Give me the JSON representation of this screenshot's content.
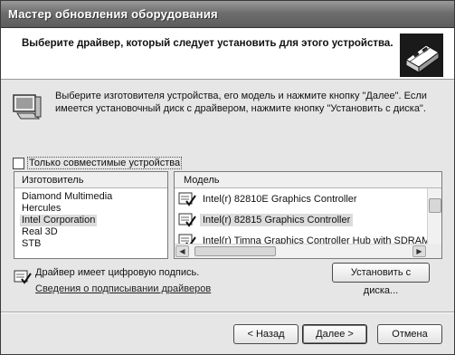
{
  "window": {
    "title": "Мастер обновления оборудования"
  },
  "header": {
    "heading": "Выберите драйвер, который следует установить для этого устройства."
  },
  "info": {
    "line1": "Выберите изготовителя устройства, его модель и нажмите кнопку \"Далее\". Если",
    "line2": "имеется установочный диск с  драйвером, нажмите кнопку \"Установить с диска\"."
  },
  "compatible": {
    "label": "Только совместимые устройства",
    "checked": false
  },
  "manufacturers": {
    "header": "Изготовитель",
    "items": [
      "Diamond Multimedia",
      "Hercules",
      "Intel Corporation",
      "Real 3D",
      "STB"
    ],
    "selected": "Intel Corporation"
  },
  "models": {
    "header": "Модель",
    "items": [
      "Intel(r) 82810E Graphics Controller",
      "Intel(r) 82815 Graphics Controller",
      "Intel(r) Timna Graphics Controller Hub with SDRAM S"
    ],
    "selected": "Intel(r) 82815 Graphics Controller"
  },
  "signature": {
    "text": "Драйвер имеет цифровую подпись.",
    "link": "Сведения о подписывании драйверов"
  },
  "buttons": {
    "have_disk": "Установить с диска...",
    "back": "< Назад",
    "next": "Далее >",
    "cancel": "Отмена"
  }
}
